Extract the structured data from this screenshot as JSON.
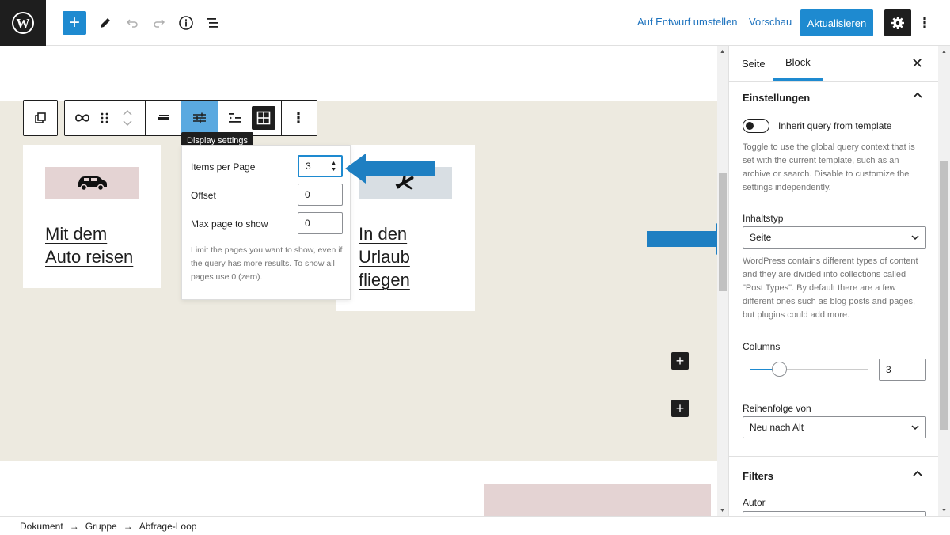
{
  "topbar": {
    "switch_to_draft": "Auf Entwurf umstellen",
    "preview": "Vorschau",
    "update": "Aktualisieren",
    "icons": [
      "wordpress-logo",
      "add-block-icon",
      "pencil-icon",
      "undo-icon",
      "redo-icon",
      "info-icon",
      "list-view-icon",
      "gear-icon",
      "more-vertical-icon"
    ],
    "accent_color": "#1e8ad0"
  },
  "canvas": {
    "tooltip": "Display settings",
    "cards": [
      {
        "title_line1": "Mit dem",
        "title_line2": "Auto reisen",
        "icon": "car-icon"
      },
      {
        "title_line1": "In den",
        "title_line2": "Urlaub",
        "title_line3": "fliegen",
        "icon": "airplane-icon"
      }
    ],
    "popover": {
      "items_per_page_label": "Items per Page",
      "items_per_page_value": "3",
      "offset_label": "Offset",
      "offset_value": "0",
      "max_page_label": "Max page to show",
      "max_page_value": "0",
      "help": "Limit the pages you want to show, even if the query has more results. To show all pages use 0 (zero)."
    }
  },
  "sidebar": {
    "tabs": [
      "Seite",
      "Block"
    ],
    "active_tab": "Block",
    "settings_heading": "Einstellungen",
    "inherit_label": "Inherit query from template",
    "inherit_checked": false,
    "inherit_help": "Toggle to use the global query context that is set with the current template, such as an archive or search. Disable to customize the settings independently.",
    "content_type_label": "Inhaltstyp",
    "content_type_value": "Seite",
    "content_type_help": "WordPress contains different types of content and they are divided into collections called \"Post Types\". By default there are a few different ones such as blog posts and pages, but plugins could add more.",
    "columns_label": "Columns",
    "columns_value": "3",
    "order_label": "Reihenfolge von",
    "order_value": "Neu nach Alt",
    "filters_heading": "Filters",
    "author_label": "Autor"
  },
  "footer": {
    "breadcrumb": [
      "Dokument",
      "Gruppe",
      "Abfrage-Loop"
    ],
    "separator": "→"
  }
}
